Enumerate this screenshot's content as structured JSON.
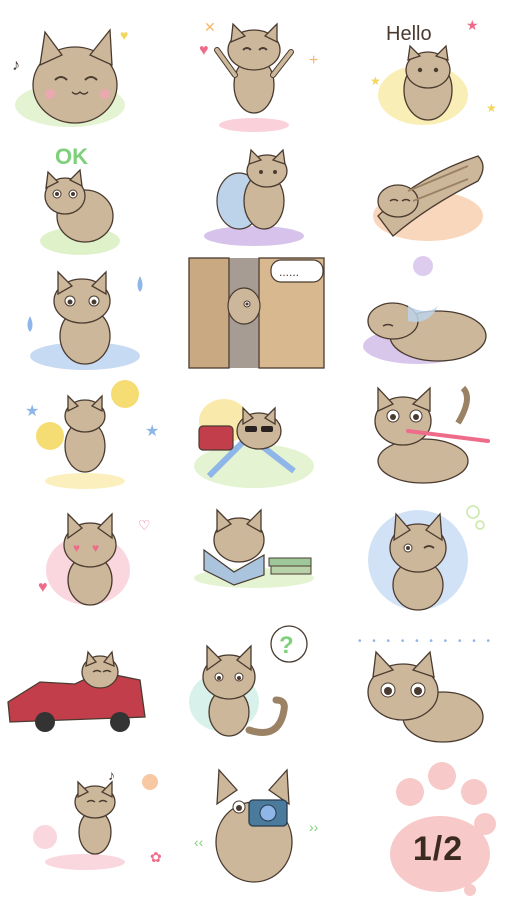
{
  "texts": {
    "hello": "Hello",
    "ok": "OK",
    "speech": "......",
    "question": "?",
    "page_number": "1/2"
  },
  "colors": {
    "cat_fur": "#cdb79a",
    "cat_stripe": "#9c8265",
    "outline": "#4a3b30",
    "pink": "#f5a3b8",
    "blue": "#8fb6e8",
    "green": "#7fd07a",
    "yellow": "#f3d65a",
    "paw": "#f8c9c9"
  }
}
